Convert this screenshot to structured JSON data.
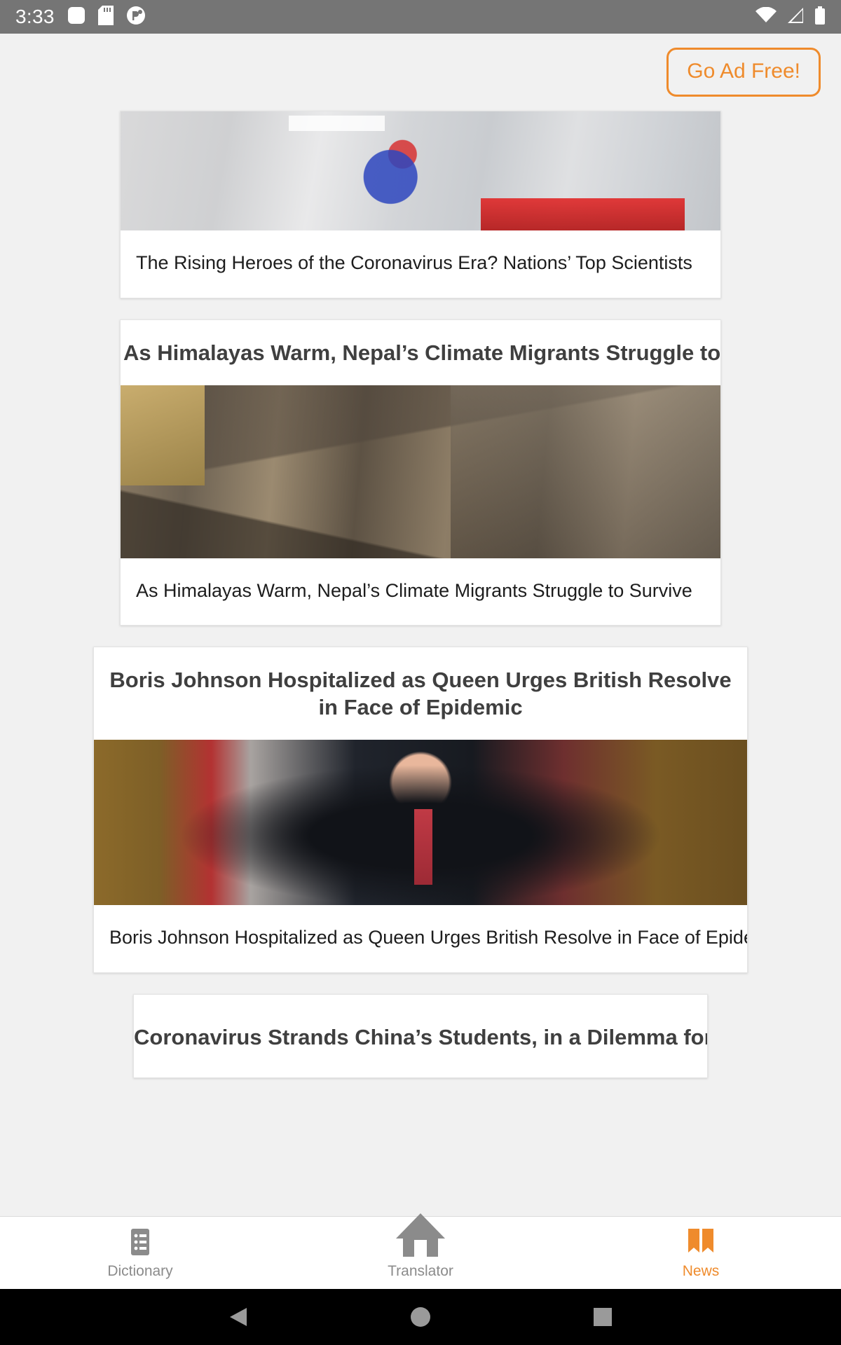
{
  "status_bar": {
    "time": "3:33",
    "left_icons": [
      "app-notification-icon",
      "sd-card-icon",
      "circle-app-icon"
    ],
    "right_icons": [
      "wifi-icon",
      "cellular-signal-icon",
      "battery-icon"
    ],
    "background_color": "#757575"
  },
  "header": {
    "ad_free_label": "Go Ad Free!",
    "accent_color": "#ef8b2c"
  },
  "feed": {
    "articles": [
      {
        "heading": "",
        "caption": "The Rising Heroes of the Coronavirus Era? Nations’ Top Scientists",
        "image_name": "laboratory-scientist-photo",
        "layout": "image-top"
      },
      {
        "heading": "As Himalayas Warm, Nepal’s Climate Migrants Struggle to Survive",
        "caption": "As Himalayas Warm, Nepal’s Climate Migrants Struggle to Survive",
        "image_name": "nepal-village-photo",
        "layout": "heading-top"
      },
      {
        "heading": "Boris Johnson Hospitalized as Queen Urges British Resolve in Face of Epidemic",
        "caption": "Boris Johnson Hospitalized as Queen Urges British Resolve in Face of Epidemic",
        "image_name": "boris-johnson-photo",
        "layout": "heading-top"
      },
      {
        "heading": "Coronavirus Strands China’s Students, in a Dilemma for Beijing",
        "caption": "",
        "image_name": "",
        "layout": "partial"
      }
    ]
  },
  "tab_bar": {
    "tabs": [
      {
        "label": "Dictionary",
        "icon": "list-icon",
        "active": false
      },
      {
        "label": "Translator",
        "icon": "home-icon",
        "active": false
      },
      {
        "label": "News",
        "icon": "book-icon",
        "active": true
      }
    ],
    "active_color": "#ef8b2c",
    "inactive_color": "#8b8b8b"
  },
  "system_nav": {
    "buttons": [
      "back-triangle-icon",
      "home-circle-icon",
      "recents-square-icon"
    ],
    "background_color": "#000000"
  }
}
